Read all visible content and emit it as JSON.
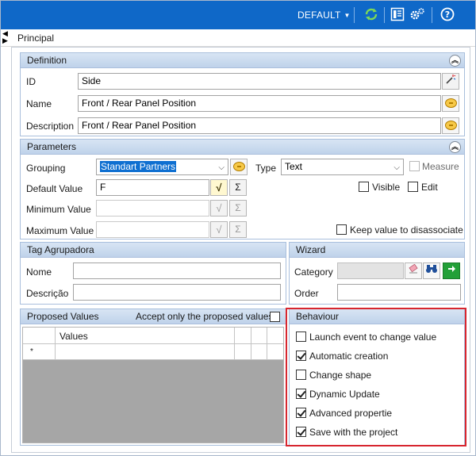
{
  "toolbar": {
    "profile": "DEFAULT",
    "icons": [
      "refresh-icon",
      "panel-layout-icon",
      "settings-gear-icon",
      "help-icon"
    ]
  },
  "tabs": {
    "current": "Principal"
  },
  "definition": {
    "title": "Definition",
    "id_label": "ID",
    "id_value": "Side",
    "name_label": "Name",
    "name_value": "Front / Rear Panel Position",
    "description_label": "Description",
    "description_value": "Front / Rear Panel Position"
  },
  "parameters": {
    "title": "Parameters",
    "grouping_label": "Grouping",
    "grouping_value": "Standart Partners",
    "type_label": "Type",
    "type_value": "Text",
    "measure_label": "Measure",
    "default_value_label": "Default Value",
    "default_value": "F",
    "minimum_value_label": "Minimum Value",
    "minimum_value": "",
    "maximum_value_label": "Maximum Value",
    "maximum_value": "",
    "visible_label": "Visible",
    "edit_label": "Edit",
    "keep_value_label": "Keep value to disassociate",
    "sigma": "Σ"
  },
  "tag_agrupadora": {
    "title": "Tag Agrupadora",
    "nome_label": "Nome",
    "nome_value": "",
    "descricao_label": "Descrição",
    "descricao_value": ""
  },
  "wizard": {
    "title": "Wizard",
    "category_label": "Category",
    "category_value": "",
    "order_label": "Order",
    "order_value": ""
  },
  "proposed_values": {
    "title": "Proposed Values",
    "accept_only_label": "Accept only the proposed values",
    "column_values": "Values",
    "new_row_marker": "*"
  },
  "behaviour": {
    "title": "Behaviour",
    "options": [
      {
        "label": "Launch event to change value",
        "checked": false
      },
      {
        "label": "Automatic creation",
        "checked": true
      },
      {
        "label": "Change shape",
        "checked": false
      },
      {
        "label": "Dynamic Update",
        "checked": true
      },
      {
        "label": "Advanced propertie",
        "checked": true
      },
      {
        "label": "Save with the project",
        "checked": true
      }
    ]
  },
  "colors": {
    "topbar": "#0f68c8",
    "group_header": "#c8d9ee",
    "highlight": "#d7262f"
  }
}
